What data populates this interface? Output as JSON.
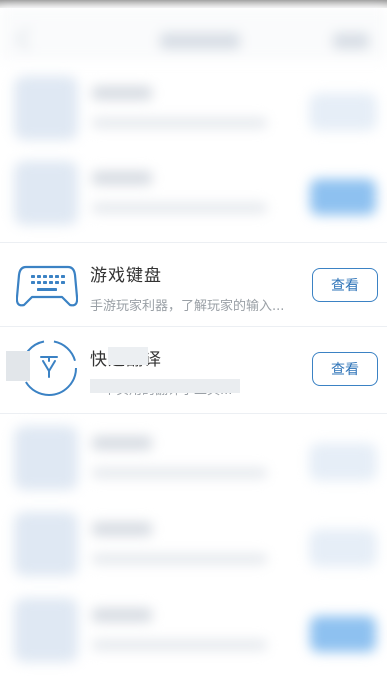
{
  "cards": [
    {
      "title": "游戏键盘",
      "description": "手游玩家利器，了解玩家的输入...",
      "button_label": "查看",
      "icon": "gamepad-keyboard-icon"
    },
    {
      "title": "快速翻译",
      "description": "一个实用的翻译小工具...",
      "button_label": "查看",
      "icon": "translate-icon"
    }
  ],
  "colors": {
    "accent": "#3b82c4",
    "title": "#333333",
    "description": "#9aa0a6"
  }
}
